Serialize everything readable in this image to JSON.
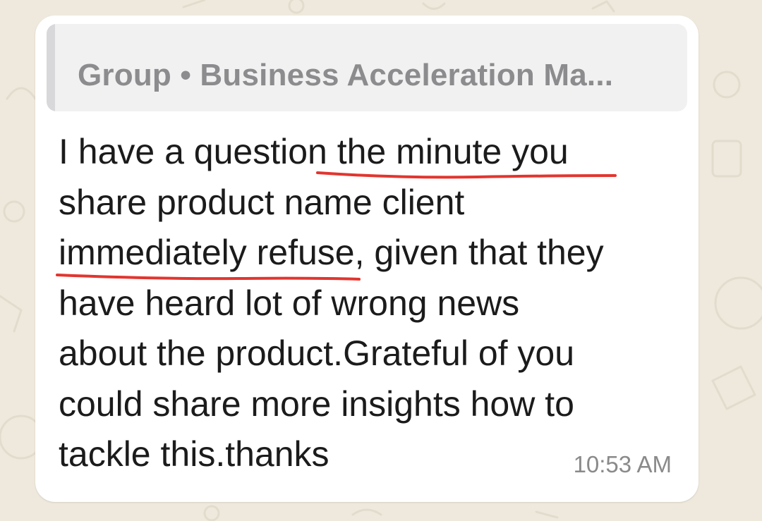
{
  "chat": {
    "quoted_group_label": "Group • Business Acceleration Ma...",
    "message_lines": [
      "I have a question the minute you",
      "share product name client",
      "immediately refuse, given that they",
      "have heard lot of wrong news",
      "about the product.Grateful of you",
      "could share more insights how to",
      "tackle this.thanks"
    ],
    "line1": {
      "pre": "I have a question ",
      "hl": "the minute you"
    },
    "line3": {
      "hl": "immediately refuse",
      "post": ", given that they"
    },
    "timestamp": "10:53 AM"
  },
  "colors": {
    "wallpaper": "#efe9dd",
    "bubble": "#ffffff",
    "quote_bg": "#f1f1f2",
    "quote_text": "#8c8c8e",
    "underline": "#e2352f",
    "message_text": "#1b1b1b",
    "timestamp_text": "#8a8a8a"
  }
}
